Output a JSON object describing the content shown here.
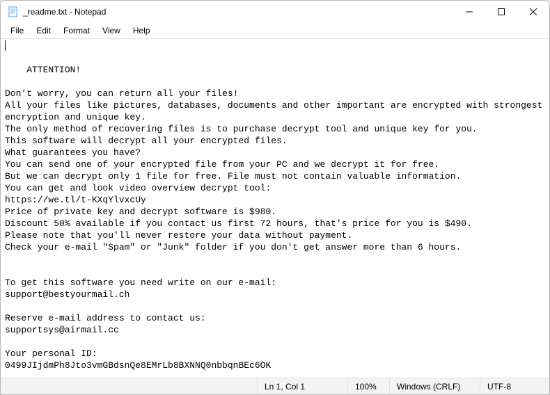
{
  "window": {
    "title": "_readme.txt - Notepad"
  },
  "menu": {
    "file": "File",
    "edit": "Edit",
    "format": "Format",
    "view": "View",
    "help": "Help"
  },
  "content": {
    "text": "ATTENTION!\n\nDon't worry, you can return all your files!\nAll your files like pictures, databases, documents and other important are encrypted with strongest encryption and unique key.\nThe only method of recovering files is to purchase decrypt tool and unique key for you.\nThis software will decrypt all your encrypted files.\nWhat guarantees you have?\nYou can send one of your encrypted file from your PC and we decrypt it for free.\nBut we can decrypt only 1 file for free. File must not contain valuable information.\nYou can get and look video overview decrypt tool:\nhttps://we.tl/t-KXqYlvxcUy\nPrice of private key and decrypt software is $980.\nDiscount 50% available if you contact us first 72 hours, that's price for you is $490.\nPlease note that you'll never restore your data without payment.\nCheck your e-mail \"Spam\" or \"Junk\" folder if you don't get answer more than 6 hours.\n\n\nTo get this software you need write on our e-mail:\nsupport@bestyourmail.ch\n\nReserve e-mail address to contact us:\nsupportsys@airmail.cc\n\nYour personal ID:\n0499JIjdmPh8Jto3vmGBdsnQe8EMrLb8BXNNQ0nbbqnBEc6OK"
  },
  "statusbar": {
    "position": "Ln 1, Col 1",
    "zoom": "100%",
    "lineending": "Windows (CRLF)",
    "encoding": "UTF-8"
  }
}
